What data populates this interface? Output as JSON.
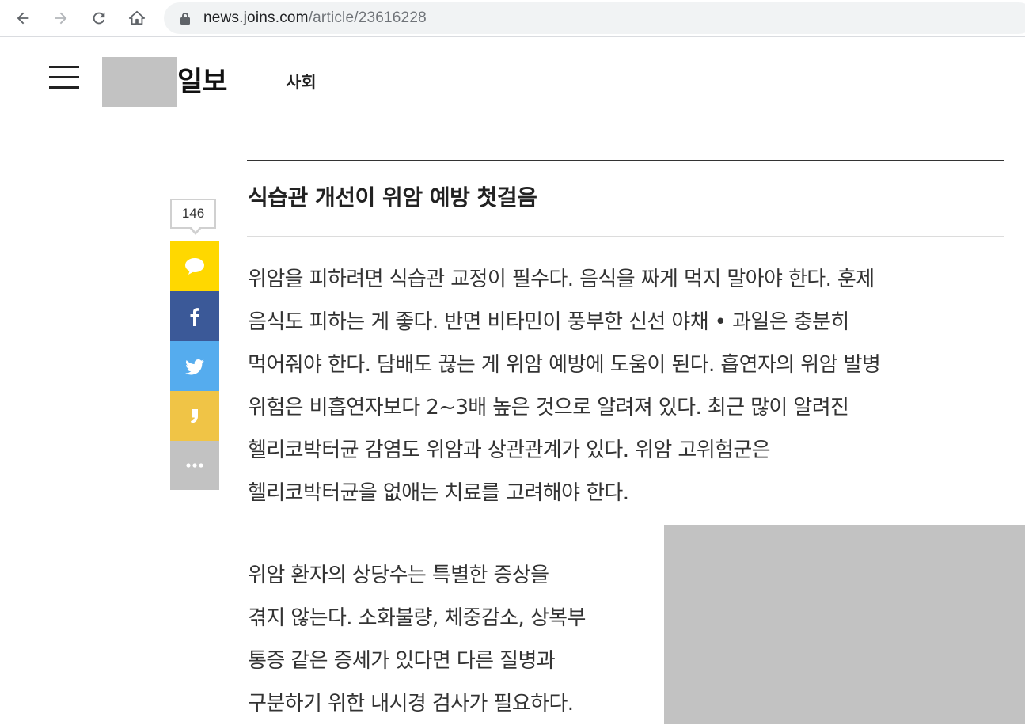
{
  "browser": {
    "url_host": "news.joins.com",
    "url_path": "/article/23616228"
  },
  "header": {
    "logo_suffix": "일보",
    "section": "사회"
  },
  "article": {
    "headline": "식습관 개선이 위암 예방 첫걸음",
    "paragraph1_lines": [
      "위암을 피하려면 식습관 교정이 필수다. 음식을 짜게 먹지 말아야 한다. 훈제",
      "음식도 피하는 게 좋다. 반면 비타민이 풍부한 신선 야채 • 과일은 충분히",
      "먹어줘야 한다. 담배도 끊는 게 위암 예방에 도움이 된다. 흡연자의 위암 발병",
      "위험은 비흡연자보다 2~3배 높은 것으로 알려져 있다. 최근 많이 알려진",
      "헬리코박터균 감염도 위암과 상관관계가 있다. 위암 고위험군은",
      "헬리코박터균을 없애는 치료를 고려해야 한다."
    ],
    "paragraph2_lines": [
      "위암 환자의 상당수는 특별한 증상을",
      "겪지 않는다. 소화불량, 체중감소, 상복부",
      "통증 같은 증세가 있다면 다른 질병과",
      "구분하기 위한 내시경 검사가 필요하다."
    ]
  },
  "share": {
    "count": "146",
    "buttons": [
      {
        "name": "kakaotalk",
        "icon": "speech-bubble-icon",
        "color": "#ffd800"
      },
      {
        "name": "facebook",
        "icon": "facebook-icon",
        "color": "#3b5998"
      },
      {
        "name": "twitter",
        "icon": "twitter-icon",
        "color": "#55acee"
      },
      {
        "name": "kakaostory",
        "icon": "kakaostory-icon",
        "color": "#f0c446"
      },
      {
        "name": "more",
        "icon": "more-icon",
        "color": "#c2c2c2"
      }
    ]
  }
}
